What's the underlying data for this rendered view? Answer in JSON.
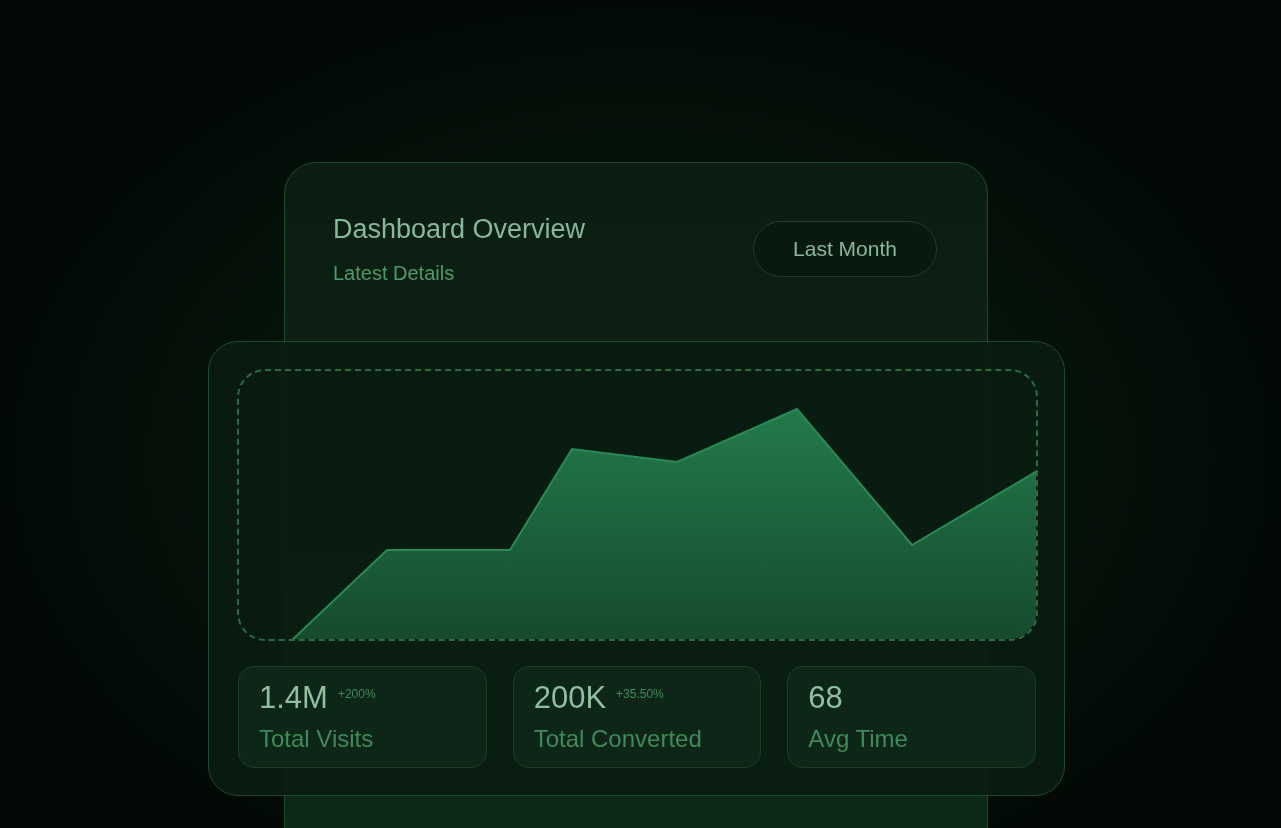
{
  "header": {
    "title": "Dashboard Overview",
    "subtitle": "Latest Details",
    "period_button": "Last Month"
  },
  "stats": [
    {
      "value": "1.4M",
      "change": "+200%",
      "label": "Total Visits"
    },
    {
      "value": "200K",
      "change": "+35.50%",
      "label": "Total Converted"
    },
    {
      "value": "68",
      "label": "Avg Time"
    }
  ]
}
